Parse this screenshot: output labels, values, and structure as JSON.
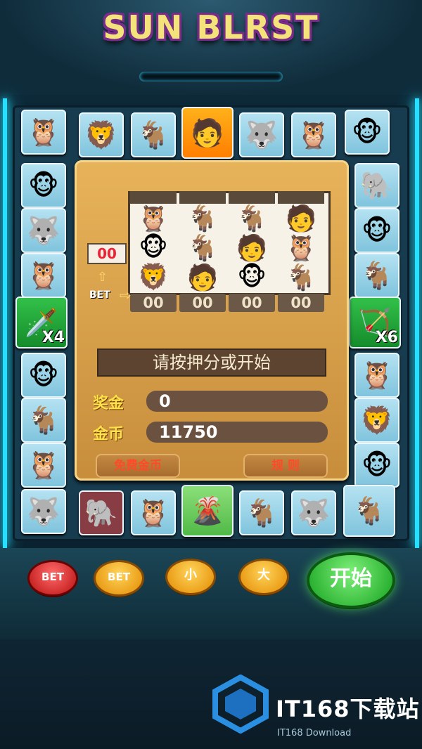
{
  "title": "SUN BLRST",
  "board": {
    "top_row": [
      "🦉",
      "🦁",
      "🐐",
      "🧑",
      "🐺",
      "🦉",
      "🐵"
    ],
    "left_col": [
      "🐵",
      "🐺",
      "🦉",
      "🗡️",
      "🐵",
      "🐐",
      "🦉"
    ],
    "right_col": [
      "🐘",
      "🐵",
      "🐐",
      "🏹",
      "🦉",
      "🦁",
      "🐵"
    ],
    "bottom_row": [
      "🐺",
      "🐘",
      "🦉",
      "🌋",
      "🐐",
      "🐺",
      "🐐"
    ],
    "left_multiplier": "X4",
    "right_multiplier": "X6"
  },
  "reels": {
    "values": [
      "00",
      "00",
      "00",
      "00"
    ],
    "symbols": [
      [
        "🦉",
        "🐵",
        "🦁"
      ],
      [
        "🐐",
        "🐐",
        "🧑"
      ],
      [
        "🐐",
        "🧑",
        "🐵"
      ],
      [
        "🧑",
        "🦉",
        "🐐"
      ]
    ],
    "credit": "00",
    "bet_label": "BET"
  },
  "message": "请按押分或开始",
  "bonus": {
    "label": "奖金",
    "value": "0"
  },
  "coins": {
    "label": "金币",
    "value": "11750"
  },
  "buttons": {
    "free_coins": "免费金币",
    "rules": "规 则",
    "bet1": "BET",
    "bet2": "BET",
    "small": "小",
    "big": "大",
    "start": "开始"
  },
  "watermark": {
    "text": "IT168下载站",
    "sub": "IT168 Download"
  }
}
